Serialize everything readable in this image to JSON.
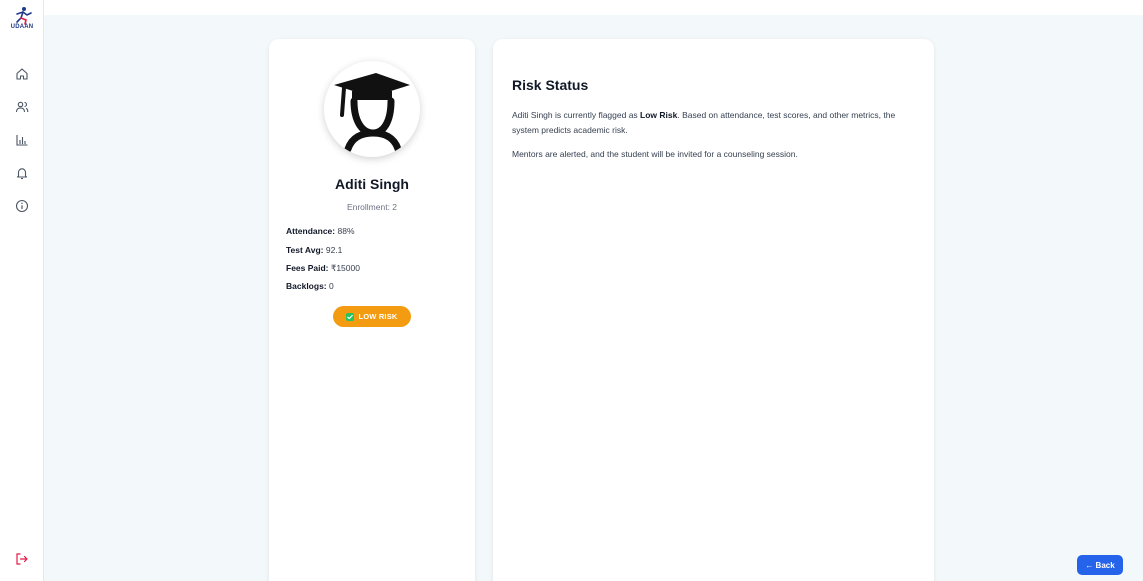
{
  "brand": {
    "name": "UDAAN"
  },
  "sidebar": {
    "items": [
      {
        "icon": "home-icon"
      },
      {
        "icon": "users-icon"
      },
      {
        "icon": "bar-chart-icon"
      },
      {
        "icon": "bell-icon"
      },
      {
        "icon": "info-icon"
      }
    ],
    "logout_icon": "logout-icon"
  },
  "student": {
    "name": "Aditi Singh",
    "enrollment": "Enrollment: 2",
    "stats": [
      {
        "label": "Attendance:",
        "value": "88%"
      },
      {
        "label": "Test Avg:",
        "value": "92.1"
      },
      {
        "label": "Fees Paid:",
        "value": "₹15000"
      },
      {
        "label": "Backlogs:",
        "value": "0"
      }
    ],
    "risk_badge": "LOW RISK"
  },
  "risk_status": {
    "title": "Risk Status",
    "p1_before": "Aditi Singh is currently flagged as ",
    "p1_bold": "Low Risk",
    "p1_after": ". Based on attendance, test scores, and other metrics, the system predicts academic risk.",
    "p2": "Mentors are alerted, and the student will be invited for a counseling session."
  },
  "back_button": "← Back",
  "colors": {
    "badge": "#f39c12",
    "back": "#2563eb",
    "logout": "#e11d48",
    "background": "#f3f8fa"
  }
}
